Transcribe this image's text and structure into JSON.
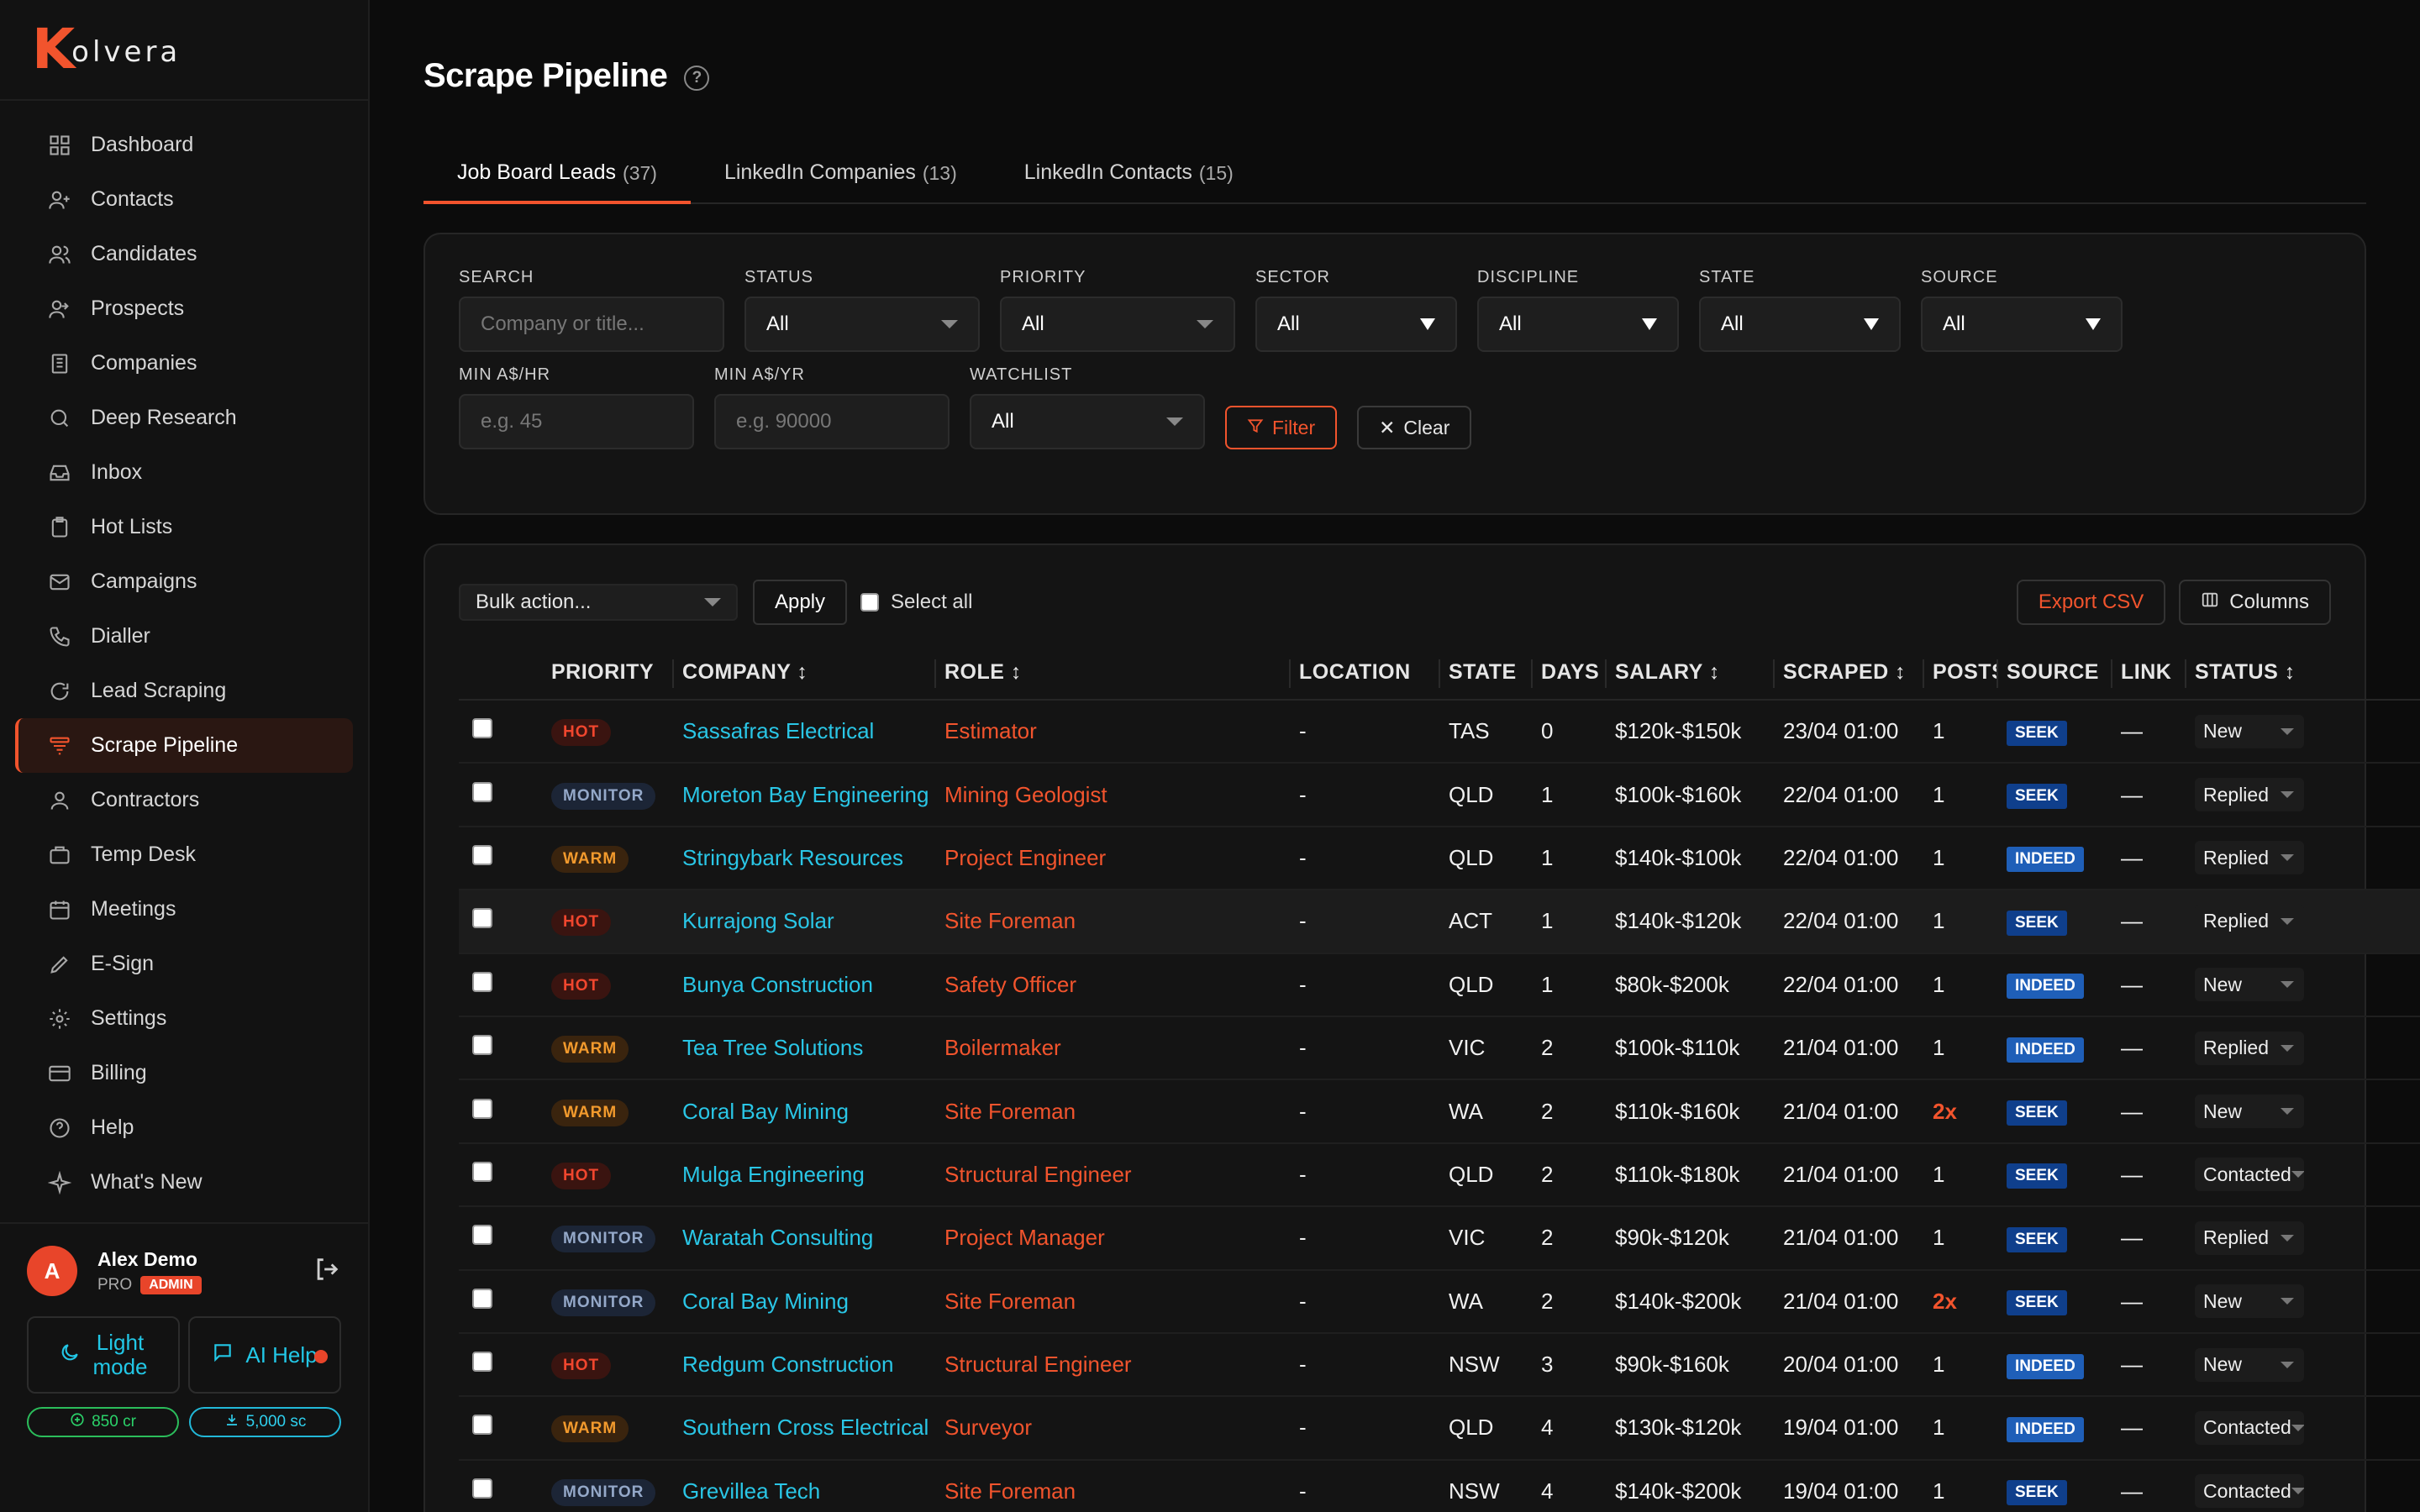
{
  "brand": {
    "k": "K",
    "rest": "olvera"
  },
  "nav": [
    {
      "label": "Dashboard",
      "icon": "grid-icon",
      "name": "nav-dashboard"
    },
    {
      "label": "Contacts",
      "icon": "user-plus-icon",
      "name": "nav-contacts"
    },
    {
      "label": "Candidates",
      "icon": "users-icon",
      "name": "nav-candidates"
    },
    {
      "label": "Prospects",
      "icon": "user-arrow-icon",
      "name": "nav-prospects"
    },
    {
      "label": "Companies",
      "icon": "building-icon",
      "name": "nav-companies"
    },
    {
      "label": "Deep Research",
      "icon": "search-icon",
      "name": "nav-deep-research"
    },
    {
      "label": "Inbox",
      "icon": "inbox-icon",
      "name": "nav-inbox"
    },
    {
      "label": "Hot Lists",
      "icon": "clipboard-icon",
      "name": "nav-hot-lists"
    },
    {
      "label": "Campaigns",
      "icon": "mail-icon",
      "name": "nav-campaigns"
    },
    {
      "label": "Dialler",
      "icon": "phone-icon",
      "name": "nav-dialler"
    },
    {
      "label": "Lead Scraping",
      "icon": "refresh-icon",
      "name": "nav-lead-scraping"
    },
    {
      "label": "Scrape Pipeline",
      "icon": "layers-icon",
      "name": "nav-scrape-pipeline",
      "active": true
    },
    {
      "label": "Contractors",
      "icon": "user-icon",
      "name": "nav-contractors"
    },
    {
      "label": "Temp Desk",
      "icon": "briefcase-icon",
      "name": "nav-temp-desk"
    },
    {
      "label": "Meetings",
      "icon": "calendar-icon",
      "name": "nav-meetings"
    },
    {
      "label": "E-Sign",
      "icon": "pen-icon",
      "name": "nav-e-sign"
    },
    {
      "label": "Settings",
      "icon": "gear-icon",
      "name": "nav-settings"
    },
    {
      "label": "Billing",
      "icon": "credit-card-icon",
      "name": "nav-billing"
    },
    {
      "label": "Help",
      "icon": "help-circle-icon",
      "name": "nav-help"
    },
    {
      "label": "What's New",
      "icon": "sparkle-icon",
      "name": "nav-whats-new"
    }
  ],
  "user": {
    "initial": "A",
    "name": "Alex Demo",
    "plan": "PRO",
    "role": "ADMIN"
  },
  "side_buttons": {
    "light_mode": "Light\nmode",
    "light_mode_l1": "Light",
    "light_mode_l2": "mode",
    "ai_help": "AI Help"
  },
  "credits": {
    "cr": "850 cr",
    "sc": "5,000 sc"
  },
  "page": {
    "title": "Scrape Pipeline"
  },
  "tabs": [
    {
      "label": "Job Board Leads",
      "count": "(37)",
      "active": true
    },
    {
      "label": "LinkedIn Companies",
      "count": "(13)"
    },
    {
      "label": "LinkedIn Contacts",
      "count": "(15)"
    }
  ],
  "filters": {
    "search": {
      "label": "SEARCH",
      "placeholder": "Company or title..."
    },
    "status": {
      "label": "STATUS",
      "value": "All"
    },
    "priority": {
      "label": "PRIORITY",
      "value": "All"
    },
    "sector": {
      "label": "SECTOR",
      "value": "All"
    },
    "discipline": {
      "label": "DISCIPLINE",
      "value": "All"
    },
    "state": {
      "label": "STATE",
      "value": "All"
    },
    "source": {
      "label": "SOURCE",
      "value": "All"
    },
    "min_hr": {
      "label": "MIN A$/HR",
      "placeholder": "e.g. 45"
    },
    "min_yr": {
      "label": "MIN A$/YR",
      "placeholder": "e.g. 90000"
    },
    "watchlist": {
      "label": "WATCHLIST",
      "value": "All"
    },
    "filter_btn": "Filter",
    "clear_btn": "Clear"
  },
  "toolbar": {
    "bulk": "Bulk action...",
    "apply": "Apply",
    "select_all": "Select all",
    "export": "Export CSV",
    "columns": "Columns"
  },
  "table": {
    "headers": [
      "",
      "PRIORITY",
      "COMPANY ↕",
      "ROLE ↕",
      "LOCATION",
      "STATE",
      "DAYS",
      "SALARY ↕",
      "SCRAPED ↕",
      "POSTS",
      "SOURCE",
      "LINK",
      "STATUS ↕"
    ],
    "rows": [
      {
        "priority": "HOT",
        "company": "Sassafras Electrical",
        "role": "Estimator",
        "location": "-",
        "state": "TAS",
        "days": "0",
        "salary": "$120k-$150k",
        "scraped": "23/04 01:00",
        "posts": "1",
        "source": "SEEK",
        "link": "—",
        "status": "New"
      },
      {
        "priority": "MONITOR",
        "company": "Moreton Bay Engineering",
        "role": "Mining Geologist",
        "location": "-",
        "state": "QLD",
        "days": "1",
        "salary": "$100k-$160k",
        "scraped": "22/04 01:00",
        "posts": "1",
        "source": "SEEK",
        "link": "—",
        "status": "Replied"
      },
      {
        "priority": "WARM",
        "company": "Stringybark Resources",
        "role": "Project Engineer",
        "location": "-",
        "state": "QLD",
        "days": "1",
        "salary": "$140k-$100k",
        "scraped": "22/04 01:00",
        "posts": "1",
        "source": "INDEED",
        "link": "—",
        "status": "Replied"
      },
      {
        "priority": "HOT",
        "company": "Kurrajong Solar",
        "role": "Site Foreman",
        "location": "-",
        "state": "ACT",
        "days": "1",
        "salary": "$140k-$120k",
        "scraped": "22/04 01:00",
        "posts": "1",
        "source": "SEEK",
        "link": "—",
        "status": "Replied",
        "highlight": true
      },
      {
        "priority": "HOT",
        "company": "Bunya Construction",
        "role": "Safety Officer",
        "location": "-",
        "state": "QLD",
        "days": "1",
        "salary": "$80k-$200k",
        "scraped": "22/04 01:00",
        "posts": "1",
        "source": "INDEED",
        "link": "—",
        "status": "New"
      },
      {
        "priority": "WARM",
        "company": "Tea Tree Solutions",
        "role": "Boilermaker",
        "location": "-",
        "state": "VIC",
        "days": "2",
        "salary": "$100k-$110k",
        "scraped": "21/04 01:00",
        "posts": "1",
        "source": "INDEED",
        "link": "—",
        "status": "Replied"
      },
      {
        "priority": "WARM",
        "company": "Coral Bay Mining",
        "role": "Site Foreman",
        "location": "-",
        "state": "WA",
        "days": "2",
        "salary": "$110k-$160k",
        "scraped": "21/04 01:00",
        "posts": "2x",
        "source": "SEEK",
        "link": "—",
        "status": "New"
      },
      {
        "priority": "HOT",
        "company": "Mulga Engineering",
        "role": "Structural Engineer",
        "location": "-",
        "state": "QLD",
        "days": "2",
        "salary": "$110k-$180k",
        "scraped": "21/04 01:00",
        "posts": "1",
        "source": "SEEK",
        "link": "—",
        "status": "Contacted"
      },
      {
        "priority": "MONITOR",
        "company": "Waratah Consulting",
        "role": "Project Manager",
        "location": "-",
        "state": "VIC",
        "days": "2",
        "salary": "$90k-$120k",
        "scraped": "21/04 01:00",
        "posts": "1",
        "source": "SEEK",
        "link": "—",
        "status": "Replied"
      },
      {
        "priority": "MONITOR",
        "company": "Coral Bay Mining",
        "role": "Site Foreman",
        "location": "-",
        "state": "WA",
        "days": "2",
        "salary": "$140k-$200k",
        "scraped": "21/04 01:00",
        "posts": "2x",
        "source": "SEEK",
        "link": "—",
        "status": "New"
      },
      {
        "priority": "HOT",
        "company": "Redgum Construction",
        "role": "Structural Engineer",
        "location": "-",
        "state": "NSW",
        "days": "3",
        "salary": "$90k-$160k",
        "scraped": "20/04 01:00",
        "posts": "1",
        "source": "INDEED",
        "link": "—",
        "status": "New"
      },
      {
        "priority": "WARM",
        "company": "Southern Cross Electrical",
        "role": "Surveyor",
        "location": "-",
        "state": "QLD",
        "days": "4",
        "salary": "$130k-$120k",
        "scraped": "19/04 01:00",
        "posts": "1",
        "source": "INDEED",
        "link": "—",
        "status": "Contacted"
      },
      {
        "priority": "MONITOR",
        "company": "Grevillea Tech",
        "role": "Site Foreman",
        "location": "-",
        "state": "NSW",
        "days": "4",
        "salary": "$140k-$200k",
        "scraped": "19/04 01:00",
        "posts": "1",
        "source": "SEEK",
        "link": "—",
        "status": "Contacted"
      }
    ]
  },
  "colors": {
    "accent": "#f2542d",
    "link": "#2ac6e6",
    "background": "#0c0c0c",
    "panel": "#141414"
  }
}
